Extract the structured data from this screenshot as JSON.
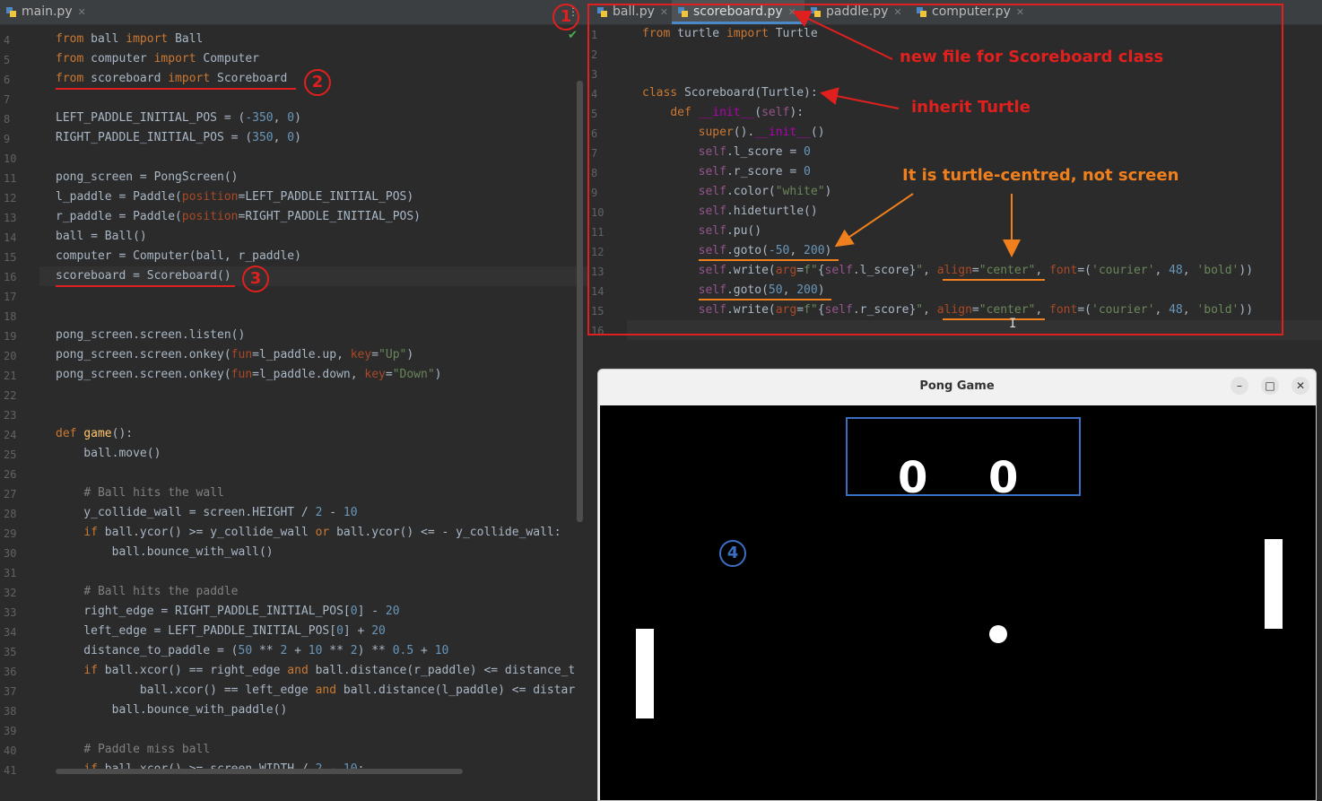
{
  "left_editor": {
    "tab": {
      "label": "main.py"
    },
    "lines": [
      {
        "num": "4",
        "html": "<span class='kw'>from</span> ball <span class='kw'>import</span> Ball"
      },
      {
        "num": "5",
        "html": "<span class='kw'>from</span> computer <span class='kw'>import</span> Computer"
      },
      {
        "num": "6",
        "html": "<span class='kw'>from</span> scoreboard <span class='kw'>import</span> Scoreboard"
      },
      {
        "num": "7",
        "html": ""
      },
      {
        "num": "8",
        "html": "LEFT_PADDLE_INITIAL_POS = (<span class='num'>-350</span>, <span class='num'>0</span>)"
      },
      {
        "num": "9",
        "html": "RIGHT_PADDLE_INITIAL_POS = (<span class='num'>350</span>, <span class='num'>0</span>)"
      },
      {
        "num": "10",
        "html": ""
      },
      {
        "num": "11",
        "html": "pong_screen = PongScreen()"
      },
      {
        "num": "12",
        "html": "l_paddle = Paddle(<span class='param'>position</span>=LEFT_PADDLE_INITIAL_POS)"
      },
      {
        "num": "13",
        "html": "r_paddle = Paddle(<span class='param'>position</span>=RIGHT_PADDLE_INITIAL_POS)"
      },
      {
        "num": "14",
        "html": "ball = Ball()"
      },
      {
        "num": "15",
        "html": "computer = Computer(ball, r_paddle)"
      },
      {
        "num": "16",
        "html": "scoreboard = Scoreboard()"
      },
      {
        "num": "17",
        "html": ""
      },
      {
        "num": "18",
        "html": ""
      },
      {
        "num": "19",
        "html": "pong_screen.screen.listen()"
      },
      {
        "num": "20",
        "html": "pong_screen.screen.onkey(<span class='param'>fun</span>=l_paddle.up, <span class='param'>key</span>=<span class='str'>\"Up\"</span>)"
      },
      {
        "num": "21",
        "html": "pong_screen.screen.onkey(<span class='param'>fun</span>=l_paddle.down, <span class='param'>key</span>=<span class='str'>\"Down\"</span>)"
      },
      {
        "num": "22",
        "html": ""
      },
      {
        "num": "23",
        "html": ""
      },
      {
        "num": "24",
        "html": "<span class='kw'>def</span> <span class='fn'>game</span>():"
      },
      {
        "num": "25",
        "html": "    ball.move()"
      },
      {
        "num": "26",
        "html": ""
      },
      {
        "num": "27",
        "html": "    <span class='cmt'># Ball hits the wall</span>"
      },
      {
        "num": "28",
        "html": "    y_collide_wall = screen.HEIGHT / <span class='num'>2</span> - <span class='num'>10</span>"
      },
      {
        "num": "29",
        "html": "    <span class='kw'>if</span> ball.ycor() >= y_collide_wall <span class='kw'>or</span> ball.ycor() <= - y_collide_wall:"
      },
      {
        "num": "30",
        "html": "        ball.bounce_with_wall()"
      },
      {
        "num": "31",
        "html": ""
      },
      {
        "num": "32",
        "html": "    <span class='cmt'># Ball hits the paddle</span>"
      },
      {
        "num": "33",
        "html": "    right_edge = RIGHT_PADDLE_INITIAL_POS[<span class='num'>0</span>] - <span class='num'>20</span>"
      },
      {
        "num": "34",
        "html": "    left_edge = LEFT_PADDLE_INITIAL_POS[<span class='num'>0</span>] + <span class='num'>20</span>"
      },
      {
        "num": "35",
        "html": "    distance_to_paddle = (<span class='num'>50</span> ** <span class='num'>2</span> + <span class='num'>10</span> ** <span class='num'>2</span>) ** <span class='num'>0.5</span> + <span class='num'>10</span>"
      },
      {
        "num": "36",
        "html": "    <span class='kw'>if</span> ball.xcor() == right_edge <span class='kw'>and</span> ball.distance(r_paddle) <= distance_t"
      },
      {
        "num": "37",
        "html": "            ball.xcor() == left_edge <span class='kw'>and</span> ball.distance(l_paddle) <= distar"
      },
      {
        "num": "38",
        "html": "        ball.bounce_with_paddle()"
      },
      {
        "num": "39",
        "html": ""
      },
      {
        "num": "40",
        "html": "    <span class='cmt'># Paddle miss ball</span>"
      },
      {
        "num": "41",
        "html": "    <span class='kw'>if</span> ball.xcor() >= screen.WIDTH / <span class='num'>2</span> - <span class='num'>10</span>:"
      }
    ]
  },
  "right_editor": {
    "tabs": [
      {
        "label": "ball.py",
        "active": false
      },
      {
        "label": "scoreboard.py",
        "active": true
      },
      {
        "label": "paddle.py",
        "active": false
      },
      {
        "label": "computer.py",
        "active": false
      }
    ],
    "lines": [
      {
        "num": "1",
        "html": "<span class='kw'>from</span> turtle <span class='kw'>import</span> Turtle"
      },
      {
        "num": "2",
        "html": ""
      },
      {
        "num": "3",
        "html": ""
      },
      {
        "num": "4",
        "html": "<span class='kw'>class</span> Scoreboard(Turtle):"
      },
      {
        "num": "5",
        "html": "    <span class='kw'>def</span> <span class='dunder'>__init__</span>(<span class='self'>self</span>):"
      },
      {
        "num": "6",
        "html": "        <span class='kw'>super</span>().<span class='dunder'>__init__</span>()"
      },
      {
        "num": "7",
        "html": "        <span class='self'>self</span>.l_score = <span class='num'>0</span>"
      },
      {
        "num": "8",
        "html": "        <span class='self'>self</span>.r_score = <span class='num'>0</span>"
      },
      {
        "num": "9",
        "html": "        <span class='self'>self</span>.color(<span class='str'>\"white\"</span>)"
      },
      {
        "num": "10",
        "html": "        <span class='self'>self</span>.hideturtle()"
      },
      {
        "num": "11",
        "html": "        <span class='self'>self</span>.pu()"
      },
      {
        "num": "12",
        "html": "        <span class='self'>self</span>.goto(<span class='num'>-50</span>, <span class='num'>200</span>)"
      },
      {
        "num": "13",
        "html": "        <span class='self'>self</span>.write(<span class='param'>arg</span>=<span class='str'>f\"</span>{<span class='self'>self</span>.l_score}<span class='str'>\"</span>, <span class='param'>align</span>=<span class='str'>\"center\"</span>, <span class='param'>font</span>=(<span class='str'>'courier'</span>, <span class='num'>48</span>, <span class='str'>'bold'</span>))"
      },
      {
        "num": "14",
        "html": "        <span class='self'>self</span>.goto(<span class='num'>50</span>, <span class='num'>200</span>)"
      },
      {
        "num": "15",
        "html": "        <span class='self'>self</span>.write(<span class='param'>arg</span>=<span class='str'>f\"</span>{<span class='self'>self</span>.r_score}<span class='str'>\"</span>, <span class='param'>align</span>=<span class='str'>\"center\"</span>, <span class='param'>font</span>=(<span class='str'>'courier'</span>, <span class='num'>48</span>, <span class='str'>'bold'</span>))"
      },
      {
        "num": "16",
        "html": ""
      }
    ]
  },
  "annotations": {
    "marker_1": "1",
    "marker_2": "2",
    "marker_3": "3",
    "marker_4": "4",
    "new_file_note": "new file for Scoreboard class",
    "inherit_note": "inherit Turtle",
    "centred_note": "It is turtle-centred, not screen"
  },
  "pong_window": {
    "title": "Pong Game",
    "minimize_label": "–",
    "maximize_label": "□",
    "close_label": "✕",
    "left_score": "0",
    "right_score": "0"
  },
  "colors": {
    "annotation_red": "#e0201e",
    "annotation_orange": "#f0801d",
    "annotation_blue": "#3a6fc4"
  }
}
